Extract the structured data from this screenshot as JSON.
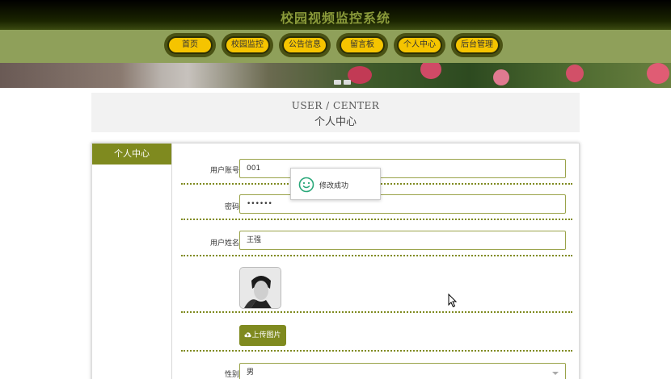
{
  "header": {
    "site_title": "校园视频监控系统"
  },
  "nav": {
    "items": [
      {
        "label": "首页"
      },
      {
        "label": "校园监控"
      },
      {
        "label": "公告信息"
      },
      {
        "label": "留言板"
      },
      {
        "label": "个人中心"
      },
      {
        "label": "后台管理"
      }
    ]
  },
  "section": {
    "title_en": "USER / CENTER",
    "title_zh": "个人中心"
  },
  "sidebar": {
    "active_tab": "个人中心"
  },
  "form": {
    "account": {
      "label": "用户账号",
      "value": "001"
    },
    "password": {
      "label": "密码",
      "value": "••••••"
    },
    "name": {
      "label": "用户姓名",
      "value": "王强"
    },
    "upload_label": "上传图片",
    "gender": {
      "label": "性别",
      "value": "男"
    }
  },
  "toast": {
    "message": "修改成功",
    "icon": "smile-icon"
  },
  "colors": {
    "accent": "#7f8a1f",
    "nav_pill": "#f5c400",
    "navbar": "#8fa05a"
  }
}
